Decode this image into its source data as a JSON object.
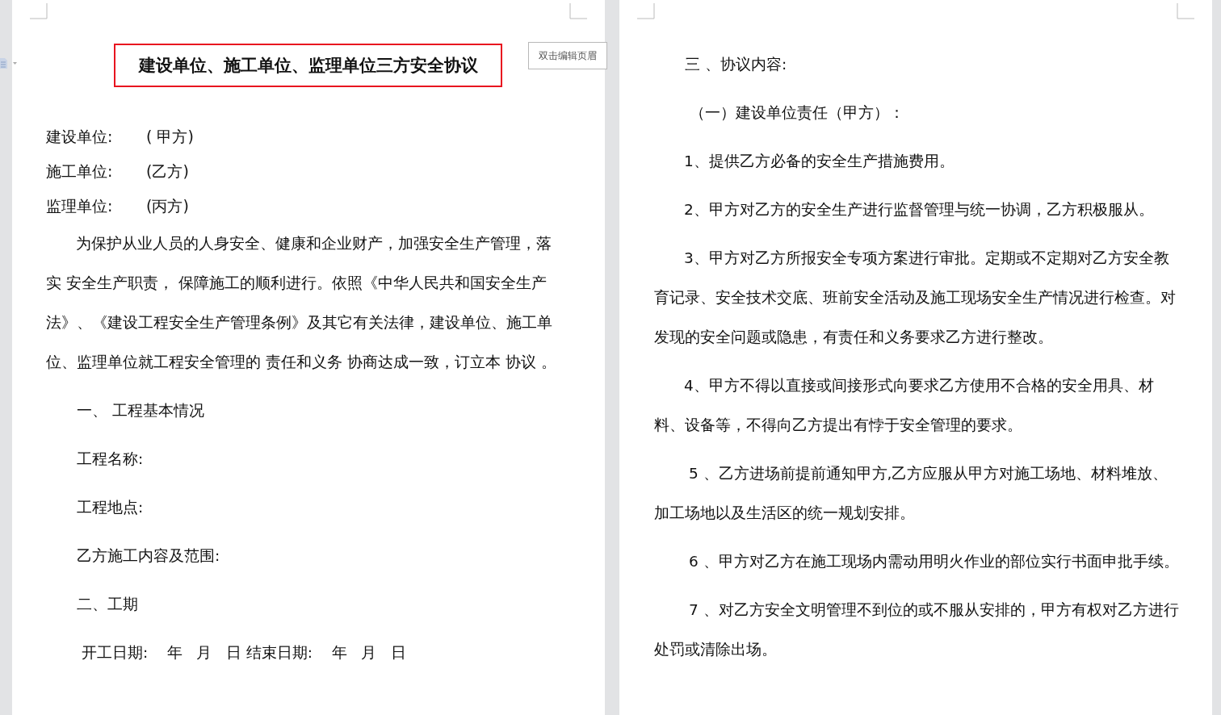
{
  "header_button": "双击编辑页眉",
  "pages": [
    {
      "blocks": [
        {
          "kind": "title",
          "text": "建设单位、施工单位、监理单位三方安全协议"
        },
        {
          "kind": "party",
          "label": "建设单位:",
          "value": "( 甲方)"
        },
        {
          "kind": "party",
          "label": "施工单位:",
          "value": "(乙方)"
        },
        {
          "kind": "party",
          "label": "监理单位:",
          "value": "(丙方)"
        },
        {
          "kind": "paragraph",
          "text": "为保护从业人员的人身安全、健康和企业财产，加强安全生产管理，落实 安全生产职责， 保障施工的顺利进行。依照《中华人民共和国安全生产法》、《建设工程安全生产管理条例》及其它有关法律，建设单位、施工单位、监理单位就工程安全管理的 责任和义务 协商达成一致，订立本 协议 。"
        },
        {
          "kind": "line",
          "text": "一、 工程基本情况"
        },
        {
          "kind": "line",
          "text": "工程名称:"
        },
        {
          "kind": "line",
          "text": "工程地点:"
        },
        {
          "kind": "line",
          "text": "乙方施工内容及范围:"
        },
        {
          "kind": "line",
          "text": "二、工期"
        },
        {
          "kind": "line",
          "text": " 开工日期:    年   月   日 结束日期:    年   月   日"
        }
      ]
    },
    {
      "blocks": [
        {
          "kind": "line",
          "text": "三 、协议内容:"
        },
        {
          "kind": "line",
          "text": " （一）建设单位责任（甲方）："
        },
        {
          "kind": "paragraph",
          "text": "1、提供乙方必备的安全生产措施费用。"
        },
        {
          "kind": "paragraph",
          "text": "2、甲方对乙方的安全生产进行监督管理与统一协调，乙方积极服从。"
        },
        {
          "kind": "paragraph",
          "text": "3、甲方对乙方所报安全专项方案进行审批。定期或不定期对乙方安全教育记录、安全技术交底、班前安全活动及施工现场安全生产情况进行检查。对发现的安全问题或隐患，有责任和义务要求乙方进行整改。"
        },
        {
          "kind": "paragraph",
          "text": "4、甲方不得以直接或间接形式向要求乙方使用不合格的安全用具、材料、设备等，不得向乙方提出有悖于安全管理的要求。"
        },
        {
          "kind": "paragraph",
          "text": " 5 、乙方进场前提前通知甲方,乙方应服从甲方对施工场地、材料堆放、加工场地以及生活区的统一规划安排。"
        },
        {
          "kind": "paragraph",
          "text": " 6 、甲方对乙方在施工现场内需动用明火作业的部位实行书面申批手续。"
        },
        {
          "kind": "paragraph",
          "text": " 7 、对乙方安全文明管理不到位的或不服从安排的，甲方有权对乙方进行处罚或清除出场。"
        }
      ]
    }
  ]
}
